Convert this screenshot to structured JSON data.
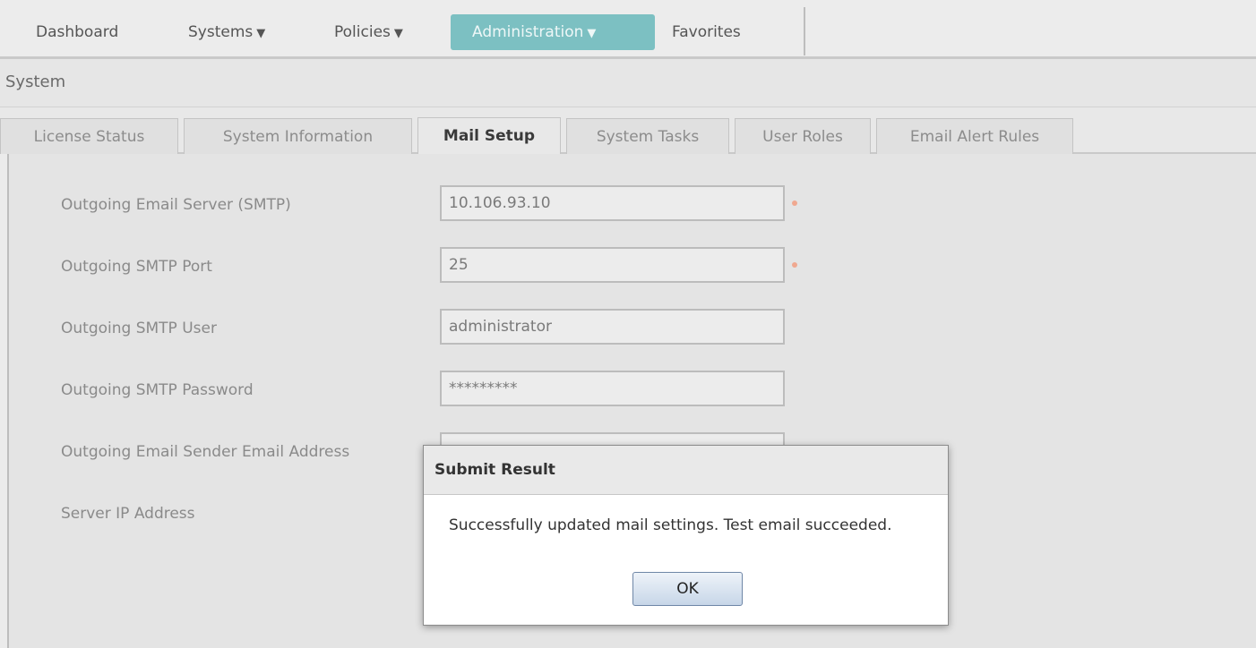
{
  "nav": {
    "items": [
      {
        "label": "Dashboard",
        "has_caret": false
      },
      {
        "label": "Systems",
        "has_caret": true
      },
      {
        "label": "Policies",
        "has_caret": true
      },
      {
        "label": "Administration",
        "has_caret": true,
        "active": true
      },
      {
        "label": "Favorites",
        "has_caret": false
      }
    ],
    "caret_icon": "▼"
  },
  "section": {
    "title": "System"
  },
  "tabs": [
    {
      "label": "License Status"
    },
    {
      "label": "System Information"
    },
    {
      "label": "Mail Setup",
      "active": true
    },
    {
      "label": "System Tasks"
    },
    {
      "label": "User Roles"
    },
    {
      "label": "Email Alert Rules"
    }
  ],
  "form": {
    "smtp_server": {
      "label": "Outgoing Email Server (SMTP)",
      "value": "10.106.93.10",
      "required": true
    },
    "smtp_port": {
      "label": "Outgoing SMTP Port",
      "value": "25",
      "required": true
    },
    "smtp_user": {
      "label": "Outgoing SMTP User",
      "value": "administrator",
      "required": false
    },
    "smtp_password": {
      "label": "Outgoing SMTP Password",
      "value": "*********",
      "required": false
    },
    "sender_email": {
      "label": "Outgoing Email Sender Email Address",
      "required": true
    },
    "server_ip": {
      "label": "Server IP Address"
    }
  },
  "dialog": {
    "title": "Submit Result",
    "message": "Successfully updated mail settings. Test email succeeded.",
    "ok_label": "OK"
  },
  "colors": {
    "accent_active_nav": "#7cc0c2",
    "required_marker": "#f0a890"
  }
}
